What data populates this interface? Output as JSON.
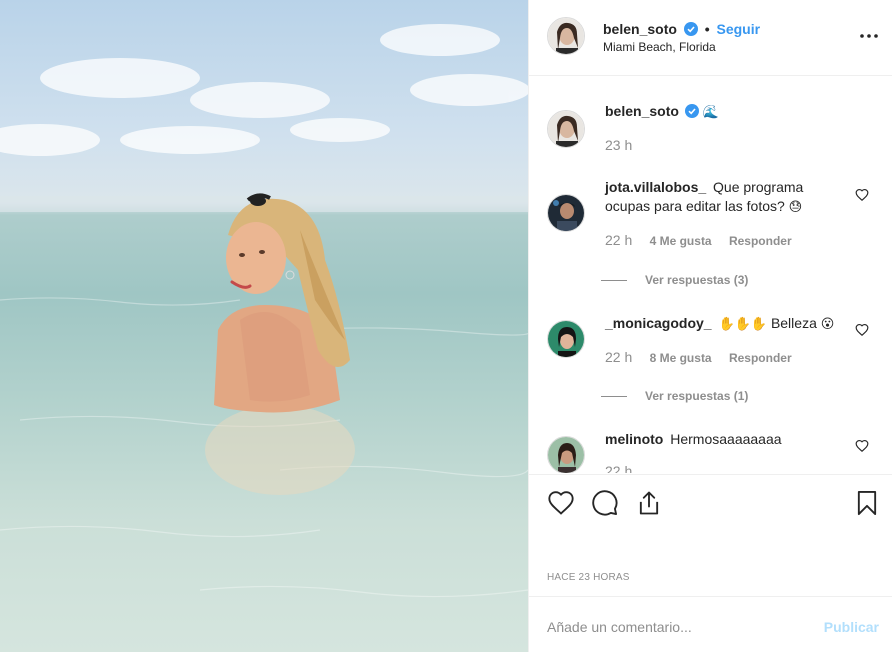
{
  "post": {
    "author": "belen_soto",
    "location": "Miami Beach, Florida",
    "follow_label": "Seguir",
    "dot": "•",
    "caption_emoji": "🌊",
    "caption_time": "23 h"
  },
  "comments": [
    {
      "user": "jota.villalobos_",
      "text": "Que programa ocupas para editar las fotos?",
      "emoji": "😓",
      "time": "22 h",
      "likes": "4 Me gusta",
      "reply": "Responder",
      "view_replies": "Ver respuestas (3)"
    },
    {
      "user": "_monicagodoy_",
      "text": "Belleza",
      "emoji_prefix": "✋✋✋",
      "emoji": "😮",
      "time": "22 h",
      "likes": "8 Me gusta",
      "reply": "Responder",
      "view_replies": "Ver respuestas (1)"
    },
    {
      "user": "melinoto",
      "text": "Hermosaaaaaaaa",
      "time": "22 h"
    }
  ],
  "footer": {
    "timestamp": "HACE 23 HORAS",
    "comment_placeholder": "Añade un comentario...",
    "publish_label": "Publicar"
  },
  "icons": {
    "like": "heart-icon",
    "comment": "comment-icon",
    "share": "share-icon",
    "save": "bookmark-icon",
    "more": "more-options-icon",
    "verified": "verified-badge-icon"
  },
  "colors": {
    "link_blue": "#3897f0",
    "muted_text": "#8e8e8e",
    "publish_disabled": "#b2dffc",
    "border": "#efefef"
  }
}
